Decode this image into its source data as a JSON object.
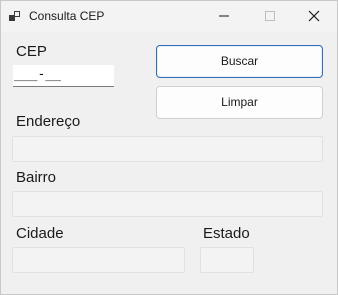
{
  "window": {
    "title": "Consulta CEP"
  },
  "form": {
    "cep_label": "CEP",
    "cep_mask": "___-__",
    "endereco_label": "Endereço",
    "bairro_label": "Bairro",
    "cidade_label": "Cidade",
    "estado_label": "Estado",
    "endereco_value": "",
    "bairro_value": "",
    "cidade_value": "",
    "estado_value": ""
  },
  "buttons": {
    "buscar": "Buscar",
    "limpar": "Limpar"
  },
  "colors": {
    "accent_border": "#2f6fb8",
    "window_bg": "#f0f0f0"
  }
}
